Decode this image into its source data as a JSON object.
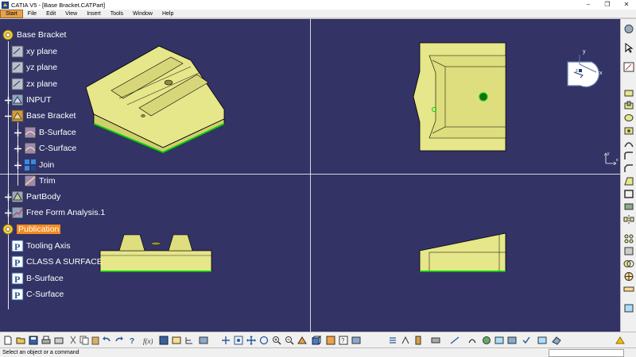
{
  "window": {
    "title": "CATIA V5 - [Base Bracket.CATPart]",
    "minimize": "–",
    "maximize": "❐",
    "close": "✕"
  },
  "menu": {
    "items": [
      {
        "label": "Start",
        "active": true
      },
      {
        "label": "File"
      },
      {
        "label": "Edit"
      },
      {
        "label": "View"
      },
      {
        "label": "Insert"
      },
      {
        "label": "Tools"
      },
      {
        "label": "Window"
      },
      {
        "label": "Help"
      }
    ]
  },
  "tree": {
    "root": "Base Bracket",
    "nodes": [
      {
        "label": "xy plane",
        "icon": "plane-icon"
      },
      {
        "label": "yz plane",
        "icon": "plane-icon"
      },
      {
        "label": "zx plane",
        "icon": "plane-icon"
      },
      {
        "label": "INPUT",
        "icon": "geometrical-set-icon"
      },
      {
        "label": "Base Bracket",
        "icon": "geometrical-set-icon"
      },
      {
        "label": "B-Surface",
        "icon": "surface-icon"
      },
      {
        "label": "C-Surface",
        "icon": "surface-icon"
      },
      {
        "label": "Join",
        "icon": "join-icon"
      },
      {
        "label": "Trim",
        "icon": "trim-icon"
      },
      {
        "label": "PartBody",
        "icon": "partbody-icon"
      },
      {
        "label": "Free Form Analysis.1",
        "icon": "analysis-icon"
      },
      {
        "label": "Publication",
        "icon": "publication-icon",
        "highlighted": true
      },
      {
        "label": "Tooling Axis",
        "icon": "publish-icon"
      },
      {
        "label": "CLASS A SURFACE",
        "icon": "publish-icon"
      },
      {
        "label": "B-Surface",
        "icon": "publish-icon"
      },
      {
        "label": "C-Surface",
        "icon": "publish-icon"
      }
    ]
  },
  "compass": {
    "x_label": "x",
    "y_label": "y",
    "z_label": "z"
  },
  "small_axis": {
    "x_label": "x",
    "y_label": "y"
  },
  "status": {
    "message": "Select an object or a command",
    "command_placeholder": ""
  },
  "colors": {
    "viewport": "#333366",
    "part_fill": "#e6e68a",
    "part_edge": "#00d000",
    "highlight": "#f28a1e"
  }
}
